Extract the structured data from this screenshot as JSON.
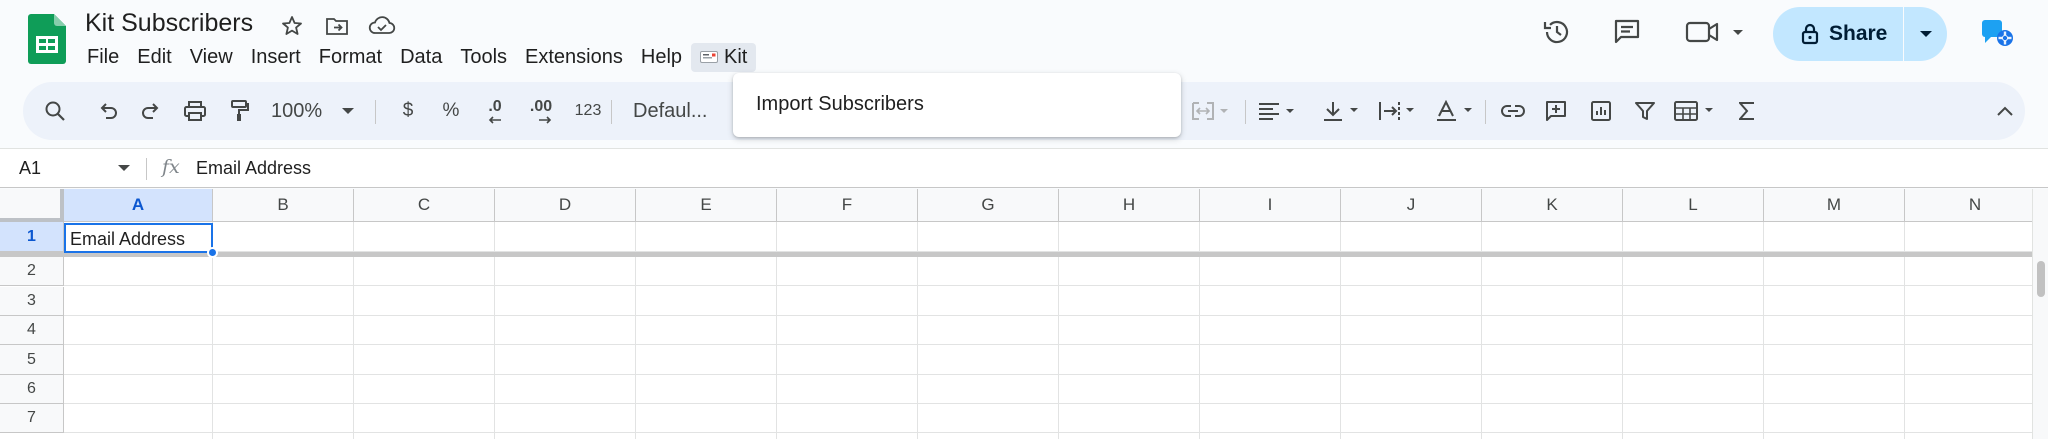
{
  "app": {
    "title": "Kit Subscribers"
  },
  "menu": [
    "File",
    "Edit",
    "View",
    "Insert",
    "Format",
    "Data",
    "Tools",
    "Extensions",
    "Help"
  ],
  "active_menu": {
    "label": "Kit"
  },
  "dropdown": {
    "items": [
      "Import Subscribers"
    ]
  },
  "share": {
    "label": "Share"
  },
  "toolbar": {
    "zoom": "100%",
    "currency": "$",
    "percent": "%",
    "dec_decrease": ".0",
    "dec_increase": ".00",
    "number_format": "123",
    "font": "Defaul..."
  },
  "formula_bar": {
    "cell_ref": "A1",
    "value": "Email Address"
  },
  "grid": {
    "columns": [
      "A",
      "B",
      "C",
      "D",
      "E",
      "F",
      "G",
      "H",
      "I",
      "J",
      "K",
      "L",
      "M",
      "N"
    ],
    "rows": [
      "1",
      "2",
      "3",
      "4",
      "5",
      "6",
      "7"
    ],
    "cells": {
      "A1": "Email Address"
    },
    "selected_cell": "A1"
  },
  "colors": {
    "accent": "#1a73e8",
    "share_bg": "#c2e7ff",
    "sheets_green": "#0f9d58",
    "toolbar_bg": "#edf2fa"
  },
  "icons": [
    "sheets-logo-icon",
    "star-icon",
    "move-folder-icon",
    "cloud-saved-icon",
    "kit-icon",
    "history-icon",
    "comments-icon",
    "meet-icon",
    "lock-icon",
    "gemini-icon",
    "search-icon",
    "undo-icon",
    "redo-icon",
    "print-icon",
    "paint-format-icon",
    "merge-cells-icon",
    "align-icon",
    "vertical-align-icon",
    "text-wrap-icon",
    "text-rotation-icon",
    "link-icon",
    "insert-comment-icon",
    "insert-chart-icon",
    "filter-icon",
    "table-view-icon",
    "sum-icon",
    "collapse-icon"
  ]
}
